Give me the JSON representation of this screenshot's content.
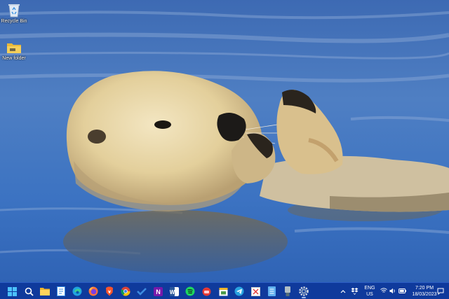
{
  "desktop": {
    "icons": [
      {
        "label": "Recycle Bin",
        "icon": "recycle-bin-icon"
      },
      {
        "label": "New folder",
        "icon": "folder-icon"
      }
    ]
  },
  "taskbar": {
    "apps": [
      {
        "name": "Start",
        "icon": "windows-start-icon"
      },
      {
        "name": "Search",
        "icon": "search-icon"
      },
      {
        "name": "File Explorer",
        "icon": "file-explorer-icon"
      },
      {
        "name": "Notepad",
        "icon": "notepad-icon"
      },
      {
        "name": "Microsoft Edge",
        "icon": "edge-icon"
      },
      {
        "name": "Firefox",
        "icon": "firefox-icon"
      },
      {
        "name": "Brave",
        "icon": "brave-icon"
      },
      {
        "name": "Google Chrome",
        "icon": "chrome-icon"
      },
      {
        "name": "To Do",
        "icon": "todo-check-icon"
      },
      {
        "name": "OneNote",
        "icon": "onenote-icon"
      },
      {
        "name": "Word",
        "icon": "word-icon"
      },
      {
        "name": "Spotify",
        "icon": "spotify-icon"
      },
      {
        "name": "App",
        "icon": "red-app-icon"
      },
      {
        "name": "Calendar",
        "icon": "calendar-icon"
      },
      {
        "name": "Telegram",
        "icon": "telegram-icon"
      },
      {
        "name": "Snipping Tool",
        "icon": "snipping-tool-icon"
      },
      {
        "name": "Notepad",
        "icon": "notepad-blue-icon"
      },
      {
        "name": "Device",
        "icon": "usb-device-icon"
      },
      {
        "name": "Settings",
        "icon": "settings-gear-icon"
      }
    ],
    "tray": {
      "icons": [
        "chevron-up-icon",
        "dropbox-icon"
      ],
      "language": "ENG",
      "region": "US",
      "status_icons": [
        "wifi-icon",
        "volume-icon",
        "battery-icon"
      ],
      "time": "7:20 PM",
      "date": "18/03/2023",
      "notification_icon": "notification-icon"
    },
    "colors": {
      "background": "#0f3a9c"
    }
  }
}
